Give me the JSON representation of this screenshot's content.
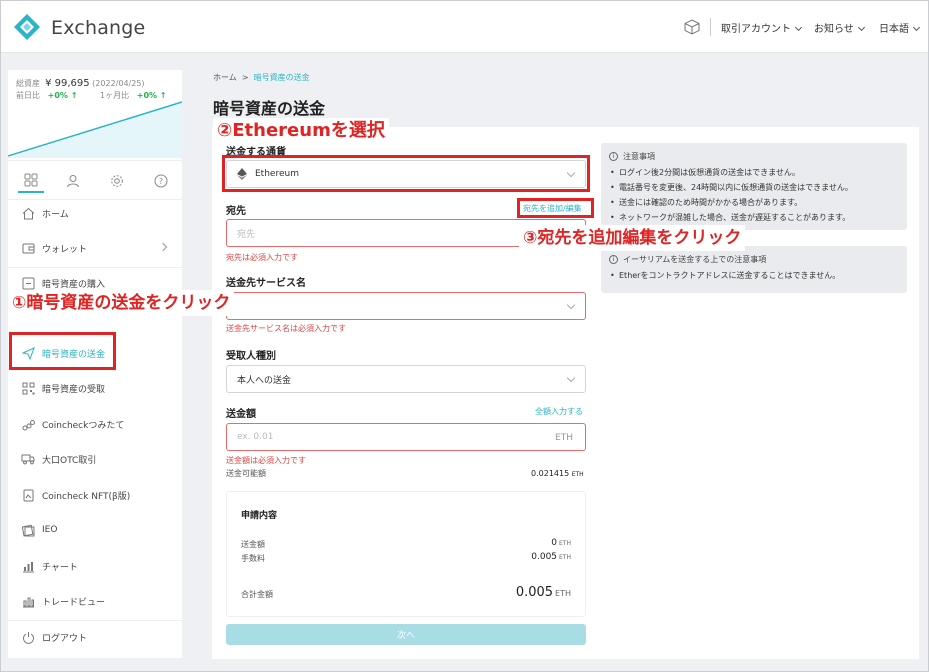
{
  "header": {
    "brand": "Exchange",
    "menu": [
      {
        "label": "取引アカウント"
      },
      {
        "label": "お知らせ"
      },
      {
        "label": "日本語"
      }
    ]
  },
  "sidebar": {
    "asset": {
      "total_label": "総資産",
      "total_value": "¥ 99,695",
      "date": "(2022/04/25)",
      "prev_day_label": "前日比",
      "prev_day_value": "+0% ↑",
      "month_label": "1ヶ月比",
      "month_value": "+0% ↑"
    },
    "items": [
      {
        "label": "ホーム"
      },
      {
        "label": "ウォレット"
      },
      {
        "label": "暗号資産の購入"
      },
      {
        "label": "暗号資産の送金"
      },
      {
        "label": "暗号資産の受取"
      },
      {
        "label": "Coincheckつみたて"
      },
      {
        "label": "大口OTC取引"
      },
      {
        "label": "Coincheck NFT(β版)"
      },
      {
        "label": "IEO"
      },
      {
        "label": "チャート"
      },
      {
        "label": "トレードビュー"
      },
      {
        "label": "ログアウト"
      }
    ]
  },
  "breadcrumb": {
    "home": "ホーム",
    "sep": ">",
    "current": "暗号資産の送金"
  },
  "page_title": "暗号資産の送金",
  "form": {
    "currency_label": "送金する通貨",
    "currency_value": "Ethereum",
    "dest_label": "宛先",
    "dest_link": "宛先を追加/編集",
    "dest_placeholder": "宛先",
    "dest_error": "宛先は必須入力です",
    "service_label": "送金先サービス名",
    "service_error": "送金先サービス名は必須入力です",
    "recipient_label": "受取人種別",
    "recipient_value": "本人への送金",
    "amount_label": "送金額",
    "amount_link": "全額入力する",
    "amount_placeholder": "ex. 0.01",
    "amount_unit": "ETH",
    "amount_error": "送金額は必須入力です",
    "available_label": "送金可能額",
    "available_value": "0.021415",
    "available_unit": "ETH"
  },
  "summary": {
    "title": "申請内容",
    "send_label": "送金額",
    "send_value": "0",
    "send_unit": "ETH",
    "fee_label": "手数料",
    "fee_value": "0.005",
    "fee_unit": "ETH",
    "total_label": "合計金額",
    "total_value": "0.005",
    "total_unit": "ETH"
  },
  "next_button": "次へ",
  "notice1": {
    "title": "注意事項",
    "items": [
      "ログイン後2分間は仮想通貨の送金はできません。",
      "電話番号を変更後、24時間以内に仮想通貨の送金はできません。",
      "送金には確認のため時間がかかる場合があります。",
      "ネットワークが混雑した場合、送金が遅延することがあります。"
    ]
  },
  "notice2": {
    "title": "イーサリアムを送金する上での注意事項",
    "items": [
      "Etherをコントラクトアドレスに送金することはできません。"
    ]
  },
  "annotations": {
    "step1": "①暗号資産の送金をクリック",
    "step2": "②Ethereumを選択",
    "step3": "③宛先を追加編集をクリック"
  },
  "colors": {
    "accent": "#2bb4c6",
    "error": "#e04545",
    "annotation": "#e02424"
  }
}
